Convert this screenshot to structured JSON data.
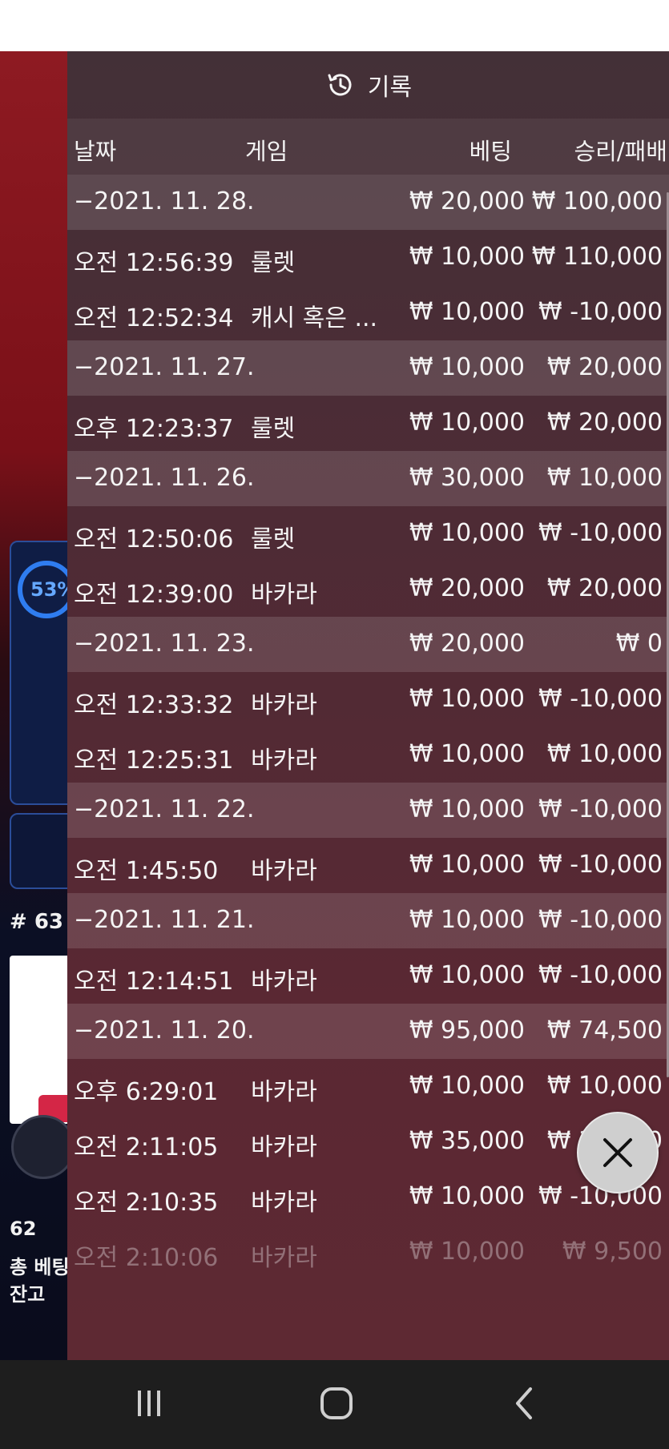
{
  "panel": {
    "title": "기록",
    "icon": "history-icon",
    "columns": {
      "date": "날짜",
      "game": "게임",
      "bet": "베팅",
      "result": "승리/패배"
    },
    "rows": [
      {
        "type": "group",
        "label": "−2021. 11. 28.",
        "bet": "₩ 20,000",
        "result": "₩ 100,000"
      },
      {
        "type": "item",
        "time": "오전 12:56:39",
        "game": "룰렛",
        "bet": "₩ 10,000",
        "result": "₩ 110,000"
      },
      {
        "type": "item",
        "time": "오전 12:52:34",
        "game": "캐시 혹은 ...",
        "bet": "₩ 10,000",
        "result": "₩ -10,000"
      },
      {
        "type": "group",
        "label": "−2021. 11. 27.",
        "bet": "₩ 10,000",
        "result": "₩ 20,000"
      },
      {
        "type": "item",
        "time": "오후 12:23:37",
        "game": "룰렛",
        "bet": "₩ 10,000",
        "result": "₩ 20,000"
      },
      {
        "type": "group",
        "label": "−2021. 11. 26.",
        "bet": "₩ 30,000",
        "result": "₩ 10,000"
      },
      {
        "type": "item",
        "time": "오전 12:50:06",
        "game": "룰렛",
        "bet": "₩ 10,000",
        "result": "₩ -10,000"
      },
      {
        "type": "item",
        "time": "오전 12:39:00",
        "game": "바카라",
        "bet": "₩ 20,000",
        "result": "₩ 20,000"
      },
      {
        "type": "group",
        "label": "−2021. 11. 23.",
        "bet": "₩ 20,000",
        "result": "₩ 0"
      },
      {
        "type": "item",
        "time": "오전 12:33:32",
        "game": "바카라",
        "bet": "₩ 10,000",
        "result": "₩ -10,000"
      },
      {
        "type": "item",
        "time": "오전 12:25:31",
        "game": "바카라",
        "bet": "₩ 10,000",
        "result": "₩ 10,000"
      },
      {
        "type": "group",
        "label": "−2021. 11. 22.",
        "bet": "₩ 10,000",
        "result": "₩ -10,000"
      },
      {
        "type": "item",
        "time": "오전 1:45:50",
        "game": "바카라",
        "bet": "₩ 10,000",
        "result": "₩ -10,000"
      },
      {
        "type": "group",
        "label": "−2021. 11. 21.",
        "bet": "₩ 10,000",
        "result": "₩ -10,000"
      },
      {
        "type": "item",
        "time": "오전 12:14:51",
        "game": "바카라",
        "bet": "₩ 10,000",
        "result": "₩ -10,000"
      },
      {
        "type": "group",
        "label": "−2021. 11. 20.",
        "bet": "₩ 95,000",
        "result": "₩ 74,500"
      },
      {
        "type": "item",
        "time": "오후 6:29:01",
        "game": "바카라",
        "bet": "₩ 10,000",
        "result": "₩ 10,000"
      },
      {
        "type": "item",
        "time": "오전 2:11:05",
        "game": "바카라",
        "bet": "₩ 35,000",
        "result": "₩ 35,000"
      },
      {
        "type": "item",
        "time": "오전 2:10:35",
        "game": "바카라",
        "bet": "₩ 10,000",
        "result": "₩ -10,000"
      },
      {
        "type": "item",
        "time": "오전 2:10:06",
        "game": "바카라",
        "bet": "₩ 10,000",
        "result": "₩ 9,500",
        "faded": true
      }
    ]
  },
  "background": {
    "progress": "53%",
    "table_number": "# 63",
    "players": "62",
    "total_bet_label": "총 베팅",
    "balance_label": "잔고"
  },
  "close_button": {
    "icon": "close-icon"
  },
  "navbar": {
    "recent": "recent-apps-icon",
    "home": "home-icon",
    "back": "back-icon"
  },
  "colors": {
    "panel": "#4e2b35",
    "group_row": "#6a4b53",
    "navbar": "#1e1e1e",
    "close": "#cfcfcf"
  }
}
